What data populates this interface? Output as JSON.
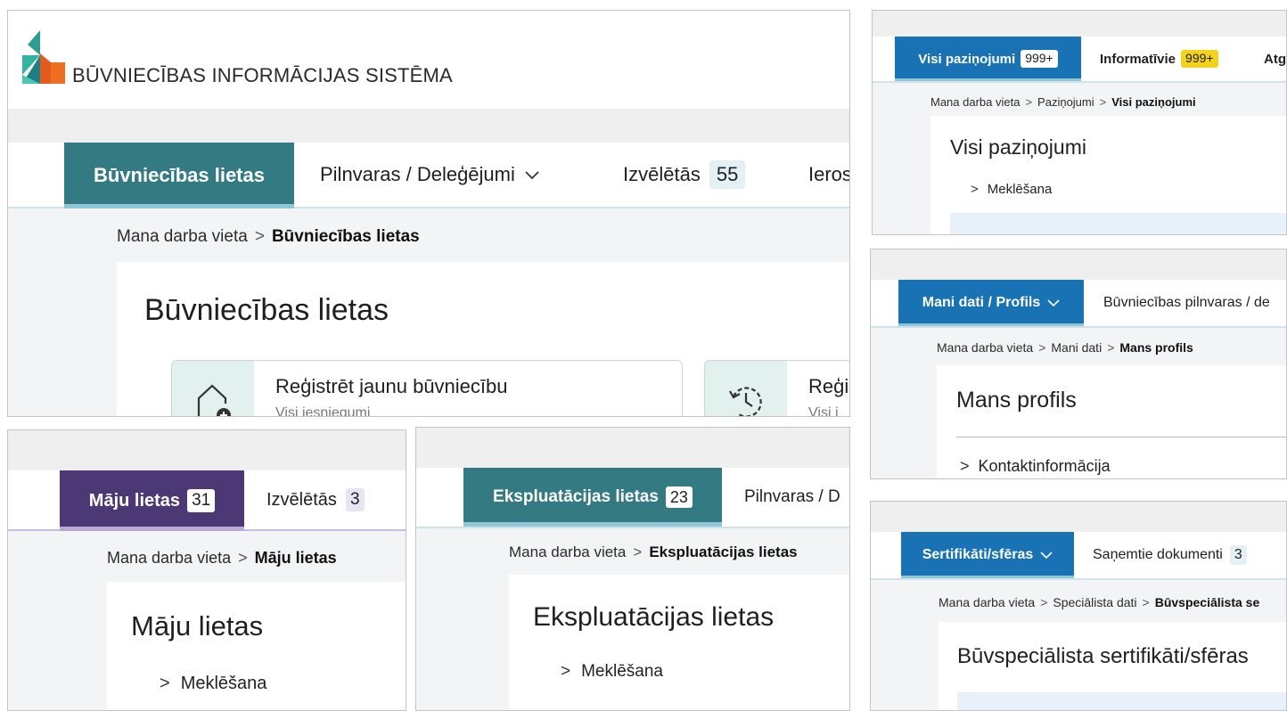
{
  "colors": {
    "teal": "#347a82",
    "purple": "#4b3875",
    "blue": "#1872b3",
    "yellow": "#f2d21b",
    "underline_light": "#8fc6d8"
  },
  "bis": {
    "logo_text": "BŪVNIECĪBAS INFORMĀCIJAS SISTĒMA",
    "tabs": [
      {
        "label": "Būvniecības lietas"
      },
      {
        "label": "Pilnvaras / Deleģējumi"
      },
      {
        "label": "Izvēlētās",
        "badge": "55"
      },
      {
        "label": "Ieros"
      }
    ],
    "breadcrumb": [
      "Mana darba vieta",
      "Būvniecības lietas"
    ],
    "title": "Būvniecības lietas",
    "tile1": {
      "title": "Reģistrēt jaunu būvniecību",
      "subtitle": "Visi iesniegumi"
    },
    "tile2": {
      "title": "Reģi",
      "subtitle": "Visi i"
    }
  },
  "majas": {
    "tabs": [
      {
        "label": "Māju lietas",
        "badge": "31"
      },
      {
        "label": "Izvēlētās",
        "badge": "3"
      }
    ],
    "breadcrumb": [
      "Mana darba vieta",
      "Māju lietas"
    ],
    "title": "Māju lietas",
    "search": "Meklēšana"
  },
  "eksp": {
    "tabs": [
      {
        "label": "Ekspluatācijas lietas",
        "badge": "23"
      },
      {
        "label": "Pilnvaras / D"
      }
    ],
    "breadcrumb": [
      "Mana darba vieta",
      "Ekspluatācijas lietas"
    ],
    "title": "Ekspluatācijas lietas",
    "search": "Meklēšana"
  },
  "pazin": {
    "tabs": [
      {
        "label": "Visi paziņojumi",
        "badge": "999+"
      },
      {
        "label": "Informatīvie",
        "badge": "999+"
      },
      {
        "label": "Atg"
      }
    ],
    "breadcrumb": [
      "Mana darba vieta",
      "Paziņojumi",
      "Visi paziņojumi"
    ],
    "title": "Visi paziņojumi",
    "search": "Meklēšana"
  },
  "profils": {
    "tabs": [
      {
        "label": "Mani dati / Profils"
      },
      {
        "label": "Būvniecības pilnvaras / de"
      }
    ],
    "breadcrumb": [
      "Mana darba vieta",
      "Mani dati",
      "Mans profils"
    ],
    "title": "Mans profils",
    "section": "Kontaktinformācija"
  },
  "sert": {
    "tabs": [
      {
        "label": "Sertifikāti/sfēras"
      },
      {
        "label": "Saņemtie dokumenti",
        "badge": "3"
      }
    ],
    "breadcrumb": [
      "Mana darba vieta",
      "Speciālista dati",
      "Būvspeciālista se"
    ],
    "title": "Būvspeciālista sertifikāti/sfēras"
  }
}
